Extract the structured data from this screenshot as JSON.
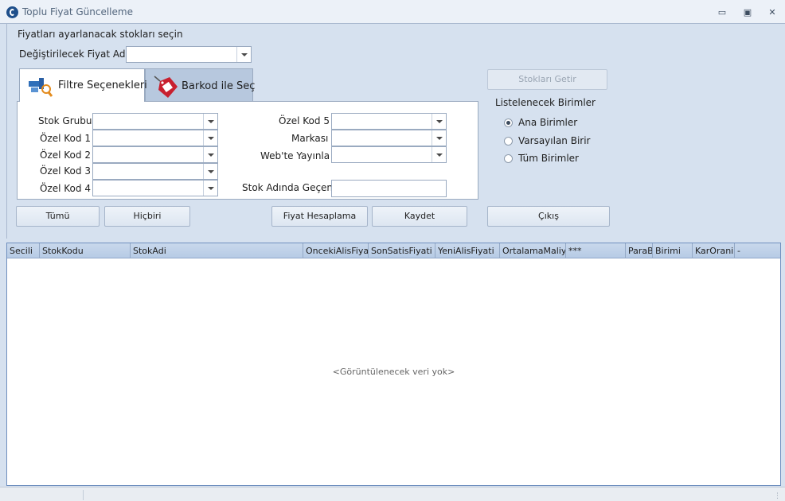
{
  "window": {
    "title": "Toplu Fiyat Güncelleme"
  },
  "header": {
    "instruction": "Fiyatları ayarlanacak stokları seçin",
    "price_name_label": "Değiştirilecek Fiyat Adı",
    "price_name_value": ""
  },
  "tabs": [
    {
      "label": "Filtre Seçenekleri",
      "icon": "filter-icon",
      "active": true
    },
    {
      "label": "Barkod ile Seç",
      "icon": "barcode-tag-icon",
      "active": false
    }
  ],
  "filters": {
    "stok_grubu": {
      "label": "Stok Grubu",
      "value": ""
    },
    "ozel_kod_1": {
      "label": "Özel Kod 1",
      "value": ""
    },
    "ozel_kod_2": {
      "label": "Özel Kod 2",
      "value": ""
    },
    "ozel_kod_3": {
      "label": "Özel Kod 3",
      "value": ""
    },
    "ozel_kod_4": {
      "label": "Özel Kod 4",
      "value": ""
    },
    "ozel_kod_5": {
      "label": "Özel Kod 5",
      "value": ""
    },
    "markasi": {
      "label": "Markası",
      "value": ""
    },
    "webte_yayinla": {
      "label": "Web'te Yayınla",
      "value": ""
    },
    "stok_adinda_gecen": {
      "label": "Stok Adında Geçen",
      "value": ""
    }
  },
  "buttons": {
    "tumu": "Tümü",
    "hicbiri": "Hiçbiri",
    "fiyat_hesaplama": "Fiyat Hesaplama",
    "kaydet": "Kaydet",
    "cikis": "Çıkış",
    "stoklari_getir": "Stokları Getir"
  },
  "units": {
    "title": "Listelenecek Birimler",
    "options": [
      "Ana Birimler",
      "Varsayılan Birir",
      "Tüm Birimler"
    ],
    "selected_index": 0
  },
  "grid": {
    "columns": [
      "Secili",
      "StokKodu",
      "StokAdi",
      "OncekiAlisFiyati",
      "SonSatisFiyati",
      "YeniAlisFiyati",
      "OrtalamaMaliyet",
      "***",
      "ParaB",
      "Birimi",
      "KarOrani",
      "-"
    ],
    "empty_text": "<Görüntülenecek veri yok>"
  }
}
